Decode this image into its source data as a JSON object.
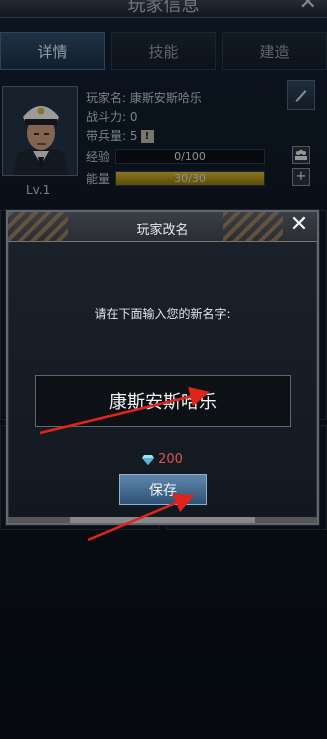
{
  "header": {
    "title": "玩家信息",
    "close_glyph": "✕"
  },
  "tabs": [
    {
      "label": "详情",
      "active": true
    },
    {
      "label": "技能",
      "active": false
    },
    {
      "label": "建造",
      "active": false
    }
  ],
  "profile": {
    "level": "Lv.1",
    "name_line": "玩家名: 康斯安斯哈乐",
    "power_line": "战斗力: 0",
    "troops_line": "带兵量: 5",
    "exp": {
      "label": "经验",
      "text": "0/100",
      "fraction": 0.0
    },
    "energy": {
      "label": "能量",
      "text": "30/30",
      "fraction": 1.0
    }
  },
  "dialog": {
    "title": "玩家改名",
    "prompt": "请在下面输入您的新名字:",
    "input_value": "康斯安斯哈乐",
    "cost": "200",
    "save_label": "保存"
  },
  "colors": {
    "accent": "#3f6a8f",
    "cost": "#e05151",
    "arrow": "#e0241b",
    "energy": "#c8aa26"
  }
}
